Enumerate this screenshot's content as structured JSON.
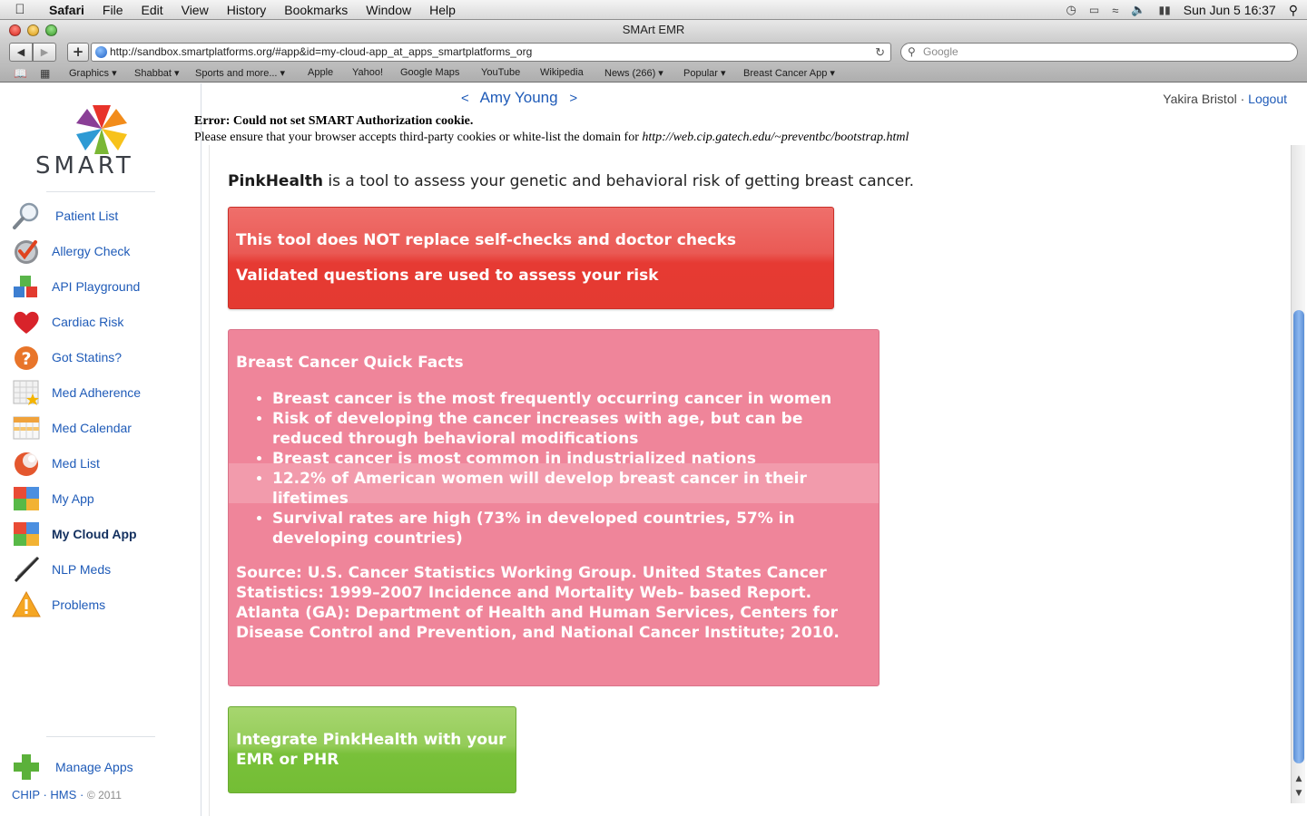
{
  "menubar": {
    "app": "Safari",
    "items": [
      "File",
      "Edit",
      "View",
      "History",
      "Bookmarks",
      "Window",
      "Help"
    ],
    "clock": "Sun Jun 5  16:37"
  },
  "window": {
    "title": "SMArt EMR"
  },
  "browser": {
    "url": "http://sandbox.smartplatforms.org/#app&id=my-cloud-app_at_apps_smartplatforms_org",
    "search_placeholder": "Google",
    "bookmarks": [
      "Graphics ▾",
      "Shabbat ▾",
      "Sports and more... ▾",
      "Apple",
      "Yahoo!",
      "Google Maps",
      "YouTube",
      "Wikipedia",
      "News (266) ▾",
      "Popular ▾",
      "Breast Cancer App ▾"
    ]
  },
  "header": {
    "patient_name": "Amy Young",
    "prev": "<",
    "next": ">",
    "user": "Yakira Bristol",
    "separator": "·",
    "logout": "Logout"
  },
  "error": {
    "title": "Error: Could not set SMART Authorization cookie.",
    "message": "Please ensure that your browser accepts third-party cookies or white-list the domain for",
    "domain": "http://web.cip.gatech.edu/~preventbc/bootstrap.html"
  },
  "sidebar": {
    "logo_text": "SMART",
    "items": [
      {
        "label": "Patient List",
        "icon": "magnifier-icon"
      },
      {
        "label": "Allergy Check",
        "icon": "checkmark-icon"
      },
      {
        "label": "API Playground",
        "icon": "blocks-icon"
      },
      {
        "label": "Cardiac Risk",
        "icon": "heart-icon"
      },
      {
        "label": "Got Statins?",
        "icon": "question-icon"
      },
      {
        "label": "Med Adherence",
        "icon": "calendar-star-icon"
      },
      {
        "label": "Med Calendar",
        "icon": "calendar-icon"
      },
      {
        "label": "Med List",
        "icon": "orb-icon"
      },
      {
        "label": "My App",
        "icon": "tiles-icon"
      },
      {
        "label": "My Cloud App",
        "icon": "tiles-icon"
      },
      {
        "label": "NLP Meds",
        "icon": "pen-icon"
      },
      {
        "label": "Problems",
        "icon": "warning-icon"
      }
    ],
    "manage_apps": "Manage Apps",
    "footer": {
      "chip": "CHIP",
      "hms": "HMS",
      "dot": "·",
      "copyright": "© 2011"
    }
  },
  "content": {
    "intro_bold": "PinkHealth",
    "intro_rest": " is a tool to assess your genetic and behavioral risk of getting breast cancer.",
    "warning_lines": [
      "This tool does NOT replace self-checks and doctor checks",
      "Validated questions are used to assess your risk"
    ],
    "facts_title": "Breast Cancer Quick Facts",
    "facts": [
      "Breast cancer is the most frequently occurring cancer in women",
      "Risk of developing the cancer increases with age, but can be reduced through behavioral modifications",
      "Breast cancer is most common in industrialized nations",
      "12.2% of American women will develop breast cancer in their lifetimes",
      "Survival rates are high (73% in developed countries, 57% in developing countries)"
    ],
    "source": "Source: U.S. Cancer Statistics Working Group. United States Cancer Statistics: 1999–2007 Incidence and Mortality Web- based Report. Atlanta (GA): Department of Health and Human Services, Centers for Disease Control and Prevention, and National Cancer Institute; 2010.",
    "integrate_label": "Integrate PinkHealth with your EMR or PHR"
  },
  "colors": {
    "link": "#1f5bb8",
    "warning_red": "#e63a33",
    "facts_pink": "#ef859a",
    "integrate_green": "#79c13a"
  }
}
